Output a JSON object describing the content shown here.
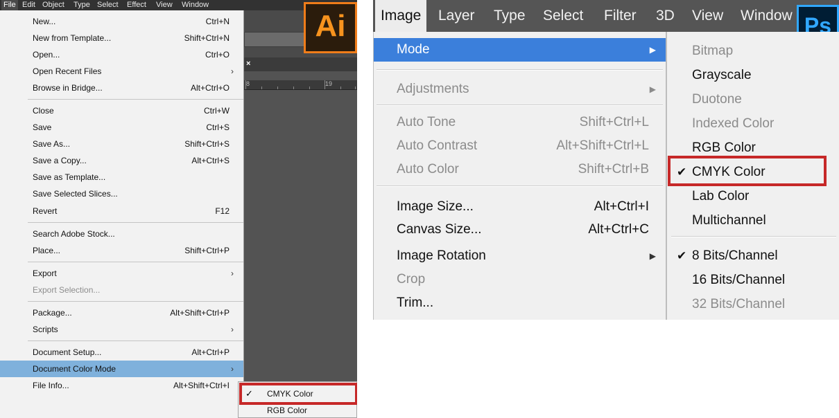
{
  "illustrator": {
    "logo_text": "Ai",
    "menubar": [
      "File",
      "Edit",
      "Object",
      "Type",
      "Select",
      "Effect",
      "View",
      "Window"
    ],
    "ruler_labels": [
      "8",
      "19"
    ],
    "tab_close_glyph": "×",
    "file_menu": [
      {
        "label": "New...",
        "shortcut": "Ctrl+N"
      },
      {
        "label": "New from Template...",
        "shortcut": "Shift+Ctrl+N"
      },
      {
        "label": "Open...",
        "shortcut": "Ctrl+O"
      },
      {
        "label": "Open Recent Files",
        "submenu_arrow": "›"
      },
      {
        "label": "Browse in Bridge...",
        "shortcut": "Alt+Ctrl+O"
      },
      {
        "label": "Close",
        "shortcut": "Ctrl+W"
      },
      {
        "label": "Save",
        "shortcut": "Ctrl+S"
      },
      {
        "label": "Save As...",
        "shortcut": "Shift+Ctrl+S"
      },
      {
        "label": "Save a Copy...",
        "shortcut": "Alt+Ctrl+S"
      },
      {
        "label": "Save as Template..."
      },
      {
        "label": "Save Selected Slices..."
      },
      {
        "label": "Revert",
        "shortcut": "F12"
      },
      {
        "label": "Search Adobe Stock..."
      },
      {
        "label": "Place...",
        "shortcut": "Shift+Ctrl+P"
      },
      {
        "label": "Export",
        "submenu_arrow": "›"
      },
      {
        "label": "Export Selection...",
        "disabled": true
      },
      {
        "label": "Package...",
        "shortcut": "Alt+Shift+Ctrl+P"
      },
      {
        "label": "Scripts",
        "submenu_arrow": "›"
      },
      {
        "label": "Document Setup...",
        "shortcut": "Alt+Ctrl+P"
      },
      {
        "label": "Document Color Mode",
        "submenu_arrow": "›",
        "highlighted": true
      },
      {
        "label": "File Info...",
        "shortcut": "Alt+Shift+Ctrl+I"
      }
    ],
    "color_mode_submenu": [
      {
        "label": "CMYK Color",
        "checked": true,
        "check": "✓"
      },
      {
        "label": "RGB Color"
      }
    ]
  },
  "photoshop": {
    "logo_text": "Ps",
    "menubar": [
      "Image",
      "Layer",
      "Type",
      "Select",
      "Filter",
      "3D",
      "View",
      "Window"
    ],
    "image_menu": [
      {
        "label": "Mode",
        "submenu_arrow": "▶",
        "highlighted": true
      },
      {
        "label": "Adjustments",
        "submenu_arrow": "▶",
        "disabled": true
      },
      {
        "label": "Auto Tone",
        "shortcut": "Shift+Ctrl+L",
        "disabled": true
      },
      {
        "label": "Auto Contrast",
        "shortcut": "Alt+Shift+Ctrl+L",
        "disabled": true
      },
      {
        "label": "Auto Color",
        "shortcut": "Shift+Ctrl+B",
        "disabled": true
      },
      {
        "label": "Image Size...",
        "shortcut": "Alt+Ctrl+I"
      },
      {
        "label": "Canvas Size...",
        "shortcut": "Alt+Ctrl+C"
      },
      {
        "label": "Image Rotation",
        "submenu_arrow": "▶"
      },
      {
        "label": "Crop",
        "disabled": true
      },
      {
        "label": "Trim..."
      }
    ],
    "mode_submenu": [
      {
        "label": "Bitmap",
        "disabled": true
      },
      {
        "label": "Grayscale"
      },
      {
        "label": "Duotone",
        "disabled": true
      },
      {
        "label": "Indexed Color",
        "disabled": true
      },
      {
        "label": "RGB Color"
      },
      {
        "label": "CMYK Color",
        "checked": true,
        "check": "✔"
      },
      {
        "label": "Lab Color"
      },
      {
        "label": "Multichannel"
      },
      {
        "label": "8 Bits/Channel",
        "checked": true,
        "check": "✔"
      },
      {
        "label": "16 Bits/Channel"
      },
      {
        "label": "32 Bits/Channel",
        "disabled": true
      }
    ]
  },
  "colors": {
    "highlight_box": "#c62828",
    "ai_selection": "#7fb1dc",
    "ps_selection": "#3b7fdb",
    "ai_brand": "#f7931e",
    "ps_brand": "#31a8ff"
  }
}
